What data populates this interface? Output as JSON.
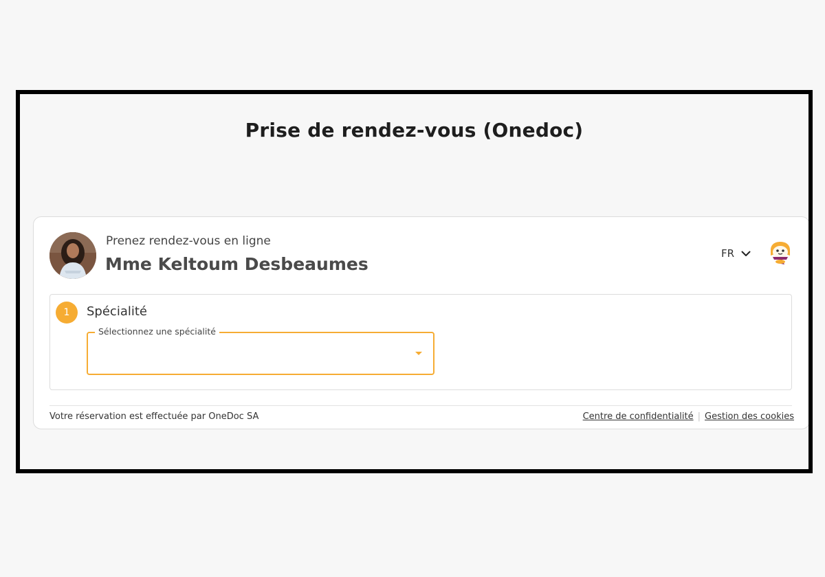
{
  "page": {
    "title": "Prise de rendez-vous (Onedoc)"
  },
  "widget": {
    "subtitle": "Prenez rendez-vous en ligne",
    "practitioner_name": "Mme Keltoum Desbeaumes",
    "language": {
      "selected": "FR",
      "icon": "chevron-down-icon"
    },
    "mascot_icon": "onedoc-mascot-icon"
  },
  "step": {
    "number": "1",
    "label": "Spécialité",
    "select": {
      "label": "Sélectionnez une spécialité",
      "value": "",
      "icon": "dropdown-arrow-icon"
    }
  },
  "footer": {
    "text": "Votre réservation est effectuée par OneDoc SA",
    "links": {
      "privacy": "Centre de confidentialité",
      "separator": "|",
      "cookies": "Gestion des cookies"
    }
  },
  "colors": {
    "accent": "#f6ac33",
    "background": "#f7f7f7",
    "card": "#ffffff",
    "border": "#dcdcdc",
    "frame": "#000000"
  }
}
